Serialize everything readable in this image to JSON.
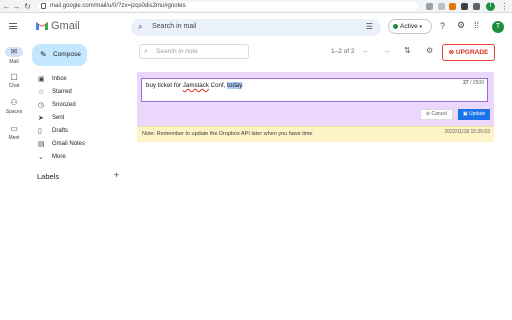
{
  "browser": {
    "url": "mail.google.com/mail/u/0/?zx=jzqs0dis3mu#gnotes",
    "profile_initial": "T"
  },
  "app": {
    "brand": "Gmail",
    "search_placeholder": "Search in mail",
    "status": "Active",
    "avatar_initial": "T"
  },
  "rail": [
    {
      "label": "Mail",
      "icon": "mail-icon"
    },
    {
      "label": "Chat",
      "icon": "chat-icon"
    },
    {
      "label": "Spaces",
      "icon": "spaces-icon"
    },
    {
      "label": "Meet",
      "icon": "meet-icon"
    }
  ],
  "sidebar": {
    "compose": "Compose",
    "items": [
      {
        "label": "Inbox",
        "icon": "inbox-icon"
      },
      {
        "label": "Starred",
        "icon": "star-icon"
      },
      {
        "label": "Snoozed",
        "icon": "clock-icon"
      },
      {
        "label": "Sent",
        "icon": "send-icon"
      },
      {
        "label": "Drafts",
        "icon": "draft-icon"
      },
      {
        "label": "Gmail Notes",
        "icon": "notes-icon"
      },
      {
        "label": "More",
        "icon": "chevron-down-icon"
      }
    ],
    "labels_heading": "Labels"
  },
  "notes": {
    "search_placeholder": "Search in note",
    "count": "1–2 of 2",
    "upgrade": "UPGRADE",
    "editor": {
      "text_before": "buy ticket for ",
      "text_squiggle": "Jamstack",
      "text_mid": " Conf, ",
      "text_selected": "today",
      "text_after": ".",
      "char_count": "27",
      "char_limit": "/ 2500",
      "cancel": "Cancel",
      "update": "Update"
    },
    "saved_note": {
      "text": "Note: Remember to update the Dropbox API later when you have time",
      "date": "2022/11/18 15:25:03"
    }
  }
}
